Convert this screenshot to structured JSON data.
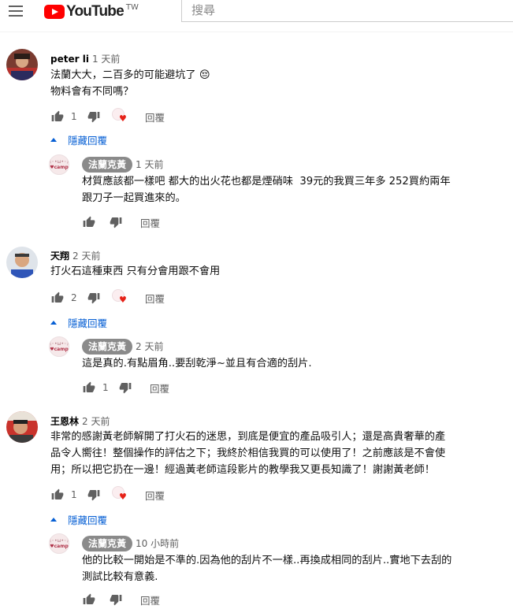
{
  "header": {
    "logo_text": "YouTube",
    "region": "TW",
    "search_placeholder": "搜尋"
  },
  "common": {
    "reply_label": "回覆",
    "hide_replies_label": "隱藏回覆",
    "creator_avatar_face": "(◦•ω•◦)",
    "creator_avatar_label": "♥camp"
  },
  "colors": {
    "link_blue": "#065fd4",
    "heart_red": "#e62117",
    "creator_chip": "#8a8a8a",
    "logo_red": "#ff0000"
  },
  "threads": [
    {
      "author": "peter li",
      "time": "1 天前",
      "text": "法蘭大大，二百多的可能避坑了 😔\n物料會有不同嗎？",
      "likes": "1",
      "reply": {
        "author": "法蘭克黃",
        "time": "1 天前",
        "text": "材質應該都一樣吧 都大的出火花也都是煙硝味  39元的我買三年多 252買約兩年\n跟刀子一起買進來的。",
        "likes": ""
      }
    },
    {
      "author": "天翔",
      "time": "2 天前",
      "text": "打火石這種東西 只有分會用跟不會用",
      "likes": "2",
      "reply": {
        "author": "法蘭克黃",
        "time": "2 天前",
        "text": "這是真的.有點眉角..要刮乾淨~並且有合適的刮片.",
        "likes": "1"
      }
    },
    {
      "author": "王恩林",
      "time": "2 天前",
      "text": "非常的感謝黃老師解開了打火石的迷思，到底是便宜的產品吸引人；還是高貴奢華的產\n品令人嚮往！整個操作的評估之下；我終於相信我買的可以使用了！之前應該是不會使\n用；所以把它扔在一邊！經過黃老師這段影片的教學我又更長知識了！謝謝黃老師！",
      "likes": "1",
      "reply": {
        "author": "法蘭克黃",
        "time": "10 小時前",
        "text": "他的比較一開始是不準的.因為他的刮片不一樣..再換成相同的刮片..實地下去刮的\n測試比較有意義.",
        "likes": ""
      }
    }
  ]
}
